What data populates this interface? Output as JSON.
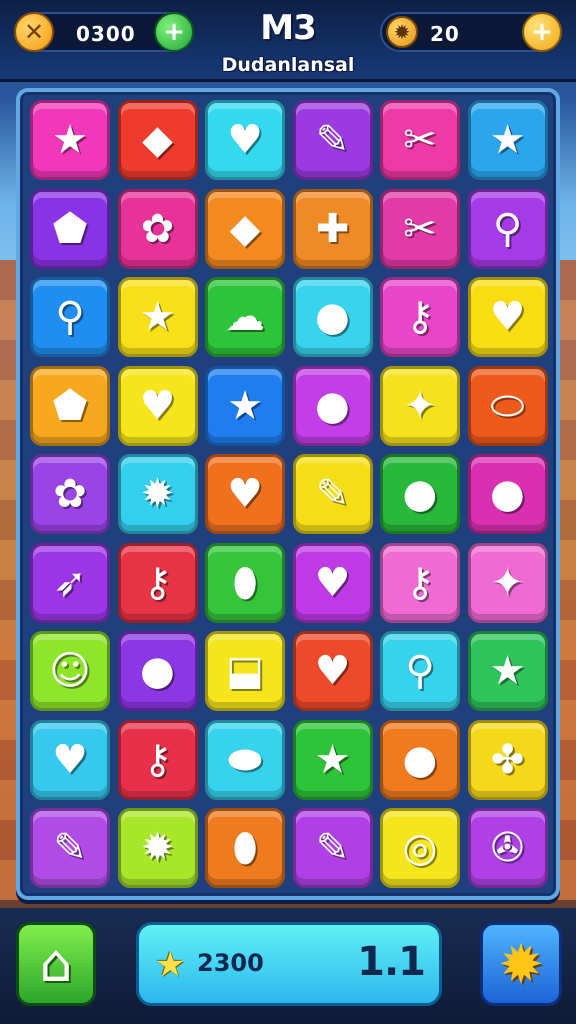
{
  "top_bar": {
    "coins_value": "0300",
    "coin_icon_glyph": "✕",
    "add_coins_glyph": "+",
    "title": "M3",
    "subtitle": "Dudanlansal",
    "gems_value": "20",
    "gem_icon_glyph": "✹",
    "add_gems_glyph": "+"
  },
  "board": {
    "rows": 9,
    "cols": 6,
    "tiles": [
      {
        "color": "#f038b8",
        "icon": "star-icon",
        "glyph": "★"
      },
      {
        "color": "#ee3b2b",
        "icon": "bandage-icon",
        "glyph": "◆"
      },
      {
        "color": "#33d9ee",
        "icon": "heart-icon",
        "glyph": "♥"
      },
      {
        "color": "#9a3ae0",
        "icon": "pencil-icon",
        "glyph": "✎"
      },
      {
        "color": "#ee3aa6",
        "icon": "scissors-icon",
        "glyph": "✂"
      },
      {
        "color": "#2ba6ee",
        "icon": "star-icon",
        "glyph": "★"
      },
      {
        "color": "#8a33e6",
        "icon": "shield-icon",
        "glyph": "⬟"
      },
      {
        "color": "#e83297",
        "icon": "gear-icon",
        "glyph": "✿"
      },
      {
        "color": "#f28a1f",
        "icon": "diamond-icon",
        "glyph": "◆"
      },
      {
        "color": "#f08a25",
        "icon": "bandage-icon",
        "glyph": "✚"
      },
      {
        "color": "#e23aa7",
        "icon": "scissors-icon",
        "glyph": "✂"
      },
      {
        "color": "#a53ae6",
        "icon": "key-icon",
        "glyph": "⚲"
      },
      {
        "color": "#1f8ef0",
        "icon": "magnifier-icon",
        "glyph": "⚲"
      },
      {
        "color": "#f7e017",
        "icon": "star-icon",
        "glyph": "★"
      },
      {
        "color": "#2ec43a",
        "icon": "blob-icon",
        "glyph": "☁"
      },
      {
        "color": "#39d3ee",
        "icon": "balloon-icon",
        "glyph": "●"
      },
      {
        "color": "#e845c8",
        "icon": "key-icon",
        "glyph": "⚷"
      },
      {
        "color": "#f7dd12",
        "icon": "heart-icon",
        "glyph": "♥"
      },
      {
        "color": "#f7a81c",
        "icon": "shield-icon",
        "glyph": "⬟"
      },
      {
        "color": "#f5e51a",
        "icon": "heart-icon",
        "glyph": "♥"
      },
      {
        "color": "#1e7ef0",
        "icon": "star-icon",
        "glyph": "★"
      },
      {
        "color": "#c23ee6",
        "icon": "balloon-icon",
        "glyph": "●"
      },
      {
        "color": "#f5e11c",
        "icon": "starfish-icon",
        "glyph": "✦"
      },
      {
        "color": "#ee5a1c",
        "icon": "tube-icon",
        "glyph": "⬭"
      },
      {
        "color": "#9a44e6",
        "icon": "gear-icon",
        "glyph": "✿"
      },
      {
        "color": "#34cfee",
        "icon": "gear-icon",
        "glyph": "✹"
      },
      {
        "color": "#f0701e",
        "icon": "heart-icon",
        "glyph": "♥"
      },
      {
        "color": "#f5de16",
        "icon": "pencil-icon",
        "glyph": "✎"
      },
      {
        "color": "#29b83a",
        "icon": "bubble-icon",
        "glyph": "●"
      },
      {
        "color": "#d92fb0",
        "icon": "pin-icon",
        "glyph": "●"
      },
      {
        "color": "#9b36e6",
        "icon": "bow-icon",
        "glyph": "➶"
      },
      {
        "color": "#e83345",
        "icon": "key-icon",
        "glyph": "⚷"
      },
      {
        "color": "#35c43a",
        "icon": "rocket-icon",
        "glyph": "⬮"
      },
      {
        "color": "#bd3ae6",
        "icon": "heart-icon",
        "glyph": "♥"
      },
      {
        "color": "#f06ad4",
        "icon": "key-icon",
        "glyph": "⚷"
      },
      {
        "color": "#f06ad4",
        "icon": "star-icon",
        "glyph": "✦"
      },
      {
        "color": "#8ee62a",
        "icon": "smiley-icon",
        "glyph": "☺"
      },
      {
        "color": "#8c36e6",
        "icon": "balloon-icon",
        "glyph": "●"
      },
      {
        "color": "#f5e51a",
        "icon": "cup-icon",
        "glyph": "⬓"
      },
      {
        "color": "#ee4a2a",
        "icon": "heart-icon",
        "glyph": "♥"
      },
      {
        "color": "#36d3ee",
        "icon": "magnifier-icon",
        "glyph": "⚲"
      },
      {
        "color": "#2ec45a",
        "icon": "star-icon",
        "glyph": "★"
      },
      {
        "color": "#36c8ee",
        "icon": "heart-icon",
        "glyph": "♥"
      },
      {
        "color": "#e8304a",
        "icon": "key-icon",
        "glyph": "⚷"
      },
      {
        "color": "#36d3ee",
        "icon": "palette-icon",
        "glyph": "⬬"
      },
      {
        "color": "#2ec43a",
        "icon": "star-icon",
        "glyph": "★"
      },
      {
        "color": "#f07a1e",
        "icon": "balloon-icon",
        "glyph": "●"
      },
      {
        "color": "#f5d81a",
        "icon": "puzzle-icon",
        "glyph": "✤"
      },
      {
        "color": "#b04ce6",
        "icon": "pencil-icon",
        "glyph": "✎"
      },
      {
        "color": "#a8e62a",
        "icon": "sun-icon",
        "glyph": "✹"
      },
      {
        "color": "#f07a1e",
        "icon": "bandage-icon",
        "glyph": "⬮"
      },
      {
        "color": "#b040e6",
        "icon": "pencil-icon",
        "glyph": "✎"
      },
      {
        "color": "#f5e51a",
        "icon": "ring-icon",
        "glyph": "◎"
      },
      {
        "color": "#b040e6",
        "icon": "whistle-icon",
        "glyph": "✇"
      }
    ]
  },
  "bottom_bar": {
    "home_glyph": "⌂",
    "star_glyph": "★",
    "score_value": "2300",
    "level_value": "1.1",
    "settings_glyph": "✹"
  }
}
